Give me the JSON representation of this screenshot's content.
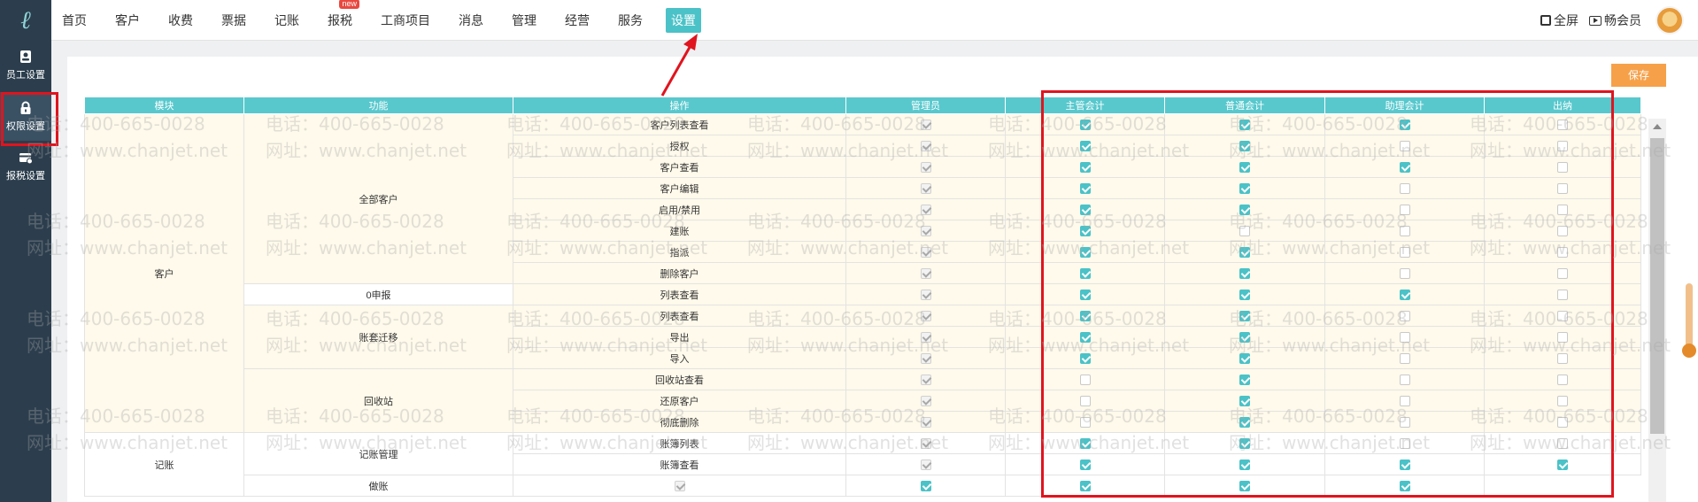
{
  "nav": {
    "items": [
      "首页",
      "客户",
      "收费",
      "票据",
      "记账",
      "报税",
      "工商项目",
      "消息",
      "管理",
      "经营",
      "服务",
      "设置"
    ],
    "active_index": 11,
    "new_badge": "new"
  },
  "top_right": {
    "fullscreen": "全屏",
    "member": "畅会员"
  },
  "sidebar": {
    "items": [
      "员工设置",
      "权限设置",
      "报税设置"
    ],
    "active_index": 1
  },
  "toolbar": {
    "save_label": "保存"
  },
  "table": {
    "headers": [
      "模块",
      "功能",
      "操作",
      "管理员",
      "主管会计",
      "普通会计",
      "助理会计",
      "出纳"
    ],
    "modules": [
      "客户",
      "记账"
    ],
    "functions": [
      "全部客户",
      "0申报",
      "账套迁移",
      "回收站",
      "记账管理"
    ],
    "rows": [
      {
        "op": "客户列表查看",
        "perms": [
          true,
          true,
          true,
          false
        ]
      },
      {
        "op": "授权",
        "perms": [
          true,
          true,
          false,
          false
        ]
      },
      {
        "op": "客户查看",
        "perms": [
          true,
          true,
          true,
          false
        ]
      },
      {
        "op": "客户编辑",
        "perms": [
          true,
          true,
          false,
          false
        ]
      },
      {
        "op": "启用/禁用",
        "perms": [
          true,
          true,
          false,
          false
        ]
      },
      {
        "op": "建账",
        "perms": [
          true,
          false,
          false,
          false
        ]
      },
      {
        "op": "指派",
        "perms": [
          true,
          true,
          false,
          false
        ]
      },
      {
        "op": "删除客户",
        "perms": [
          true,
          true,
          false,
          false
        ]
      },
      {
        "op": "列表查看",
        "perms": [
          true,
          true,
          true,
          false
        ]
      },
      {
        "op": "列表查看",
        "perms": [
          true,
          true,
          false,
          false
        ]
      },
      {
        "op": "导出",
        "perms": [
          true,
          true,
          false,
          false
        ]
      },
      {
        "op": "导入",
        "perms": [
          true,
          true,
          false,
          false
        ]
      },
      {
        "op": "回收站查看",
        "perms": [
          false,
          true,
          false,
          false
        ]
      },
      {
        "op": "还原客户",
        "perms": [
          false,
          true,
          false,
          false
        ]
      },
      {
        "op": "彻底删除",
        "perms": [
          false,
          true,
          false,
          false
        ]
      },
      {
        "op": "账簿列表",
        "perms": [
          true,
          true,
          false,
          false
        ]
      },
      {
        "op": "账簿查看",
        "perms": [
          true,
          true,
          true,
          true
        ]
      },
      {
        "op": "做账",
        "perms": [
          true,
          true,
          true,
          true
        ]
      }
    ]
  },
  "watermark": {
    "phone": "电话：400-665-0028",
    "site": "网址：www.chanjet.net"
  },
  "colors": {
    "accent": "#4bc2c7",
    "header": "#58c8cd",
    "row_bg": "#fffaeb",
    "save": "#f6a14a",
    "highlight": "#e0141e"
  }
}
